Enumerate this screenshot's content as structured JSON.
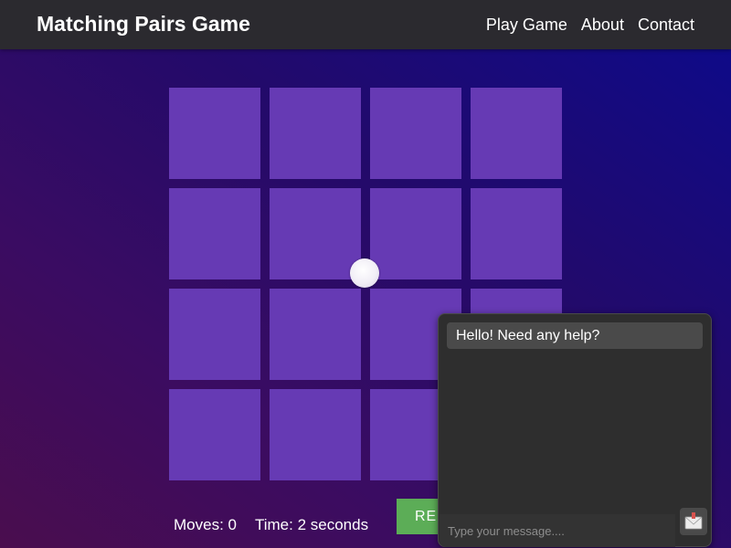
{
  "header": {
    "title": "Matching Pairs Game",
    "nav": [
      {
        "label": "Play Game"
      },
      {
        "label": "About"
      },
      {
        "label": "Contact"
      }
    ]
  },
  "game": {
    "cards": 16,
    "card_color": "#663ab4",
    "moves_text": "Moves: 0",
    "time_text": "Time: 2 seconds",
    "restart_label": "RE",
    "restart_color": "#5cad57"
  },
  "chat": {
    "message": "Hello! Need any help?",
    "input_placeholder": "Type your message....",
    "send_icon": "envelope-icon"
  }
}
